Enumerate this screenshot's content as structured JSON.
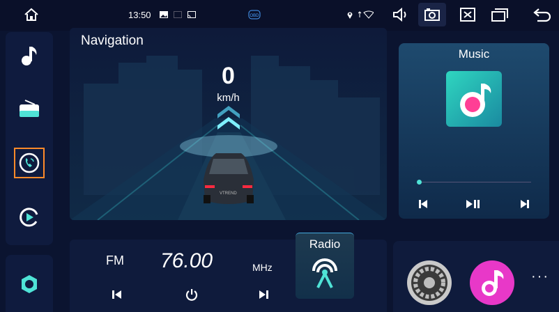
{
  "status": {
    "time": "13:50"
  },
  "nav": {
    "title": "Navigation",
    "speed": "0",
    "unit": "km/h",
    "car_badge": "VTREND"
  },
  "radio": {
    "band": "FM",
    "frequency": "76.00",
    "unit": "MHz",
    "tile_label": "Radio"
  },
  "music": {
    "title": "Music",
    "progress": 0.02
  },
  "apps": {
    "more": "···"
  },
  "colors": {
    "accent": "#ff8a2a",
    "cyan": "#4fe3d6",
    "pink": "#ff3f95"
  }
}
